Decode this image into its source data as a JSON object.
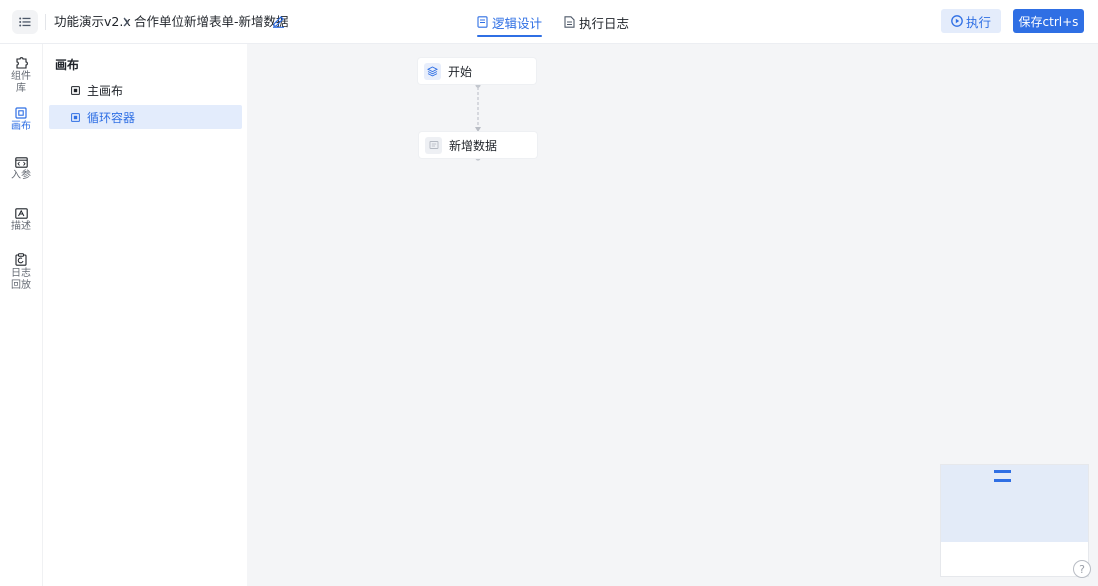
{
  "header": {
    "breadcrumb_app": "功能演示v2.x",
    "breadcrumb_page": "合作单位新增表单-新增数据",
    "tabs": [
      {
        "label": "逻辑设计",
        "active": true
      },
      {
        "label": "执行日志",
        "active": false
      }
    ],
    "run_label": "执行",
    "save_label": "保存ctrl+s"
  },
  "rail": {
    "items": [
      {
        "label": "组件库",
        "icon": "puzzle-icon",
        "active": false
      },
      {
        "label": "画布",
        "icon": "canvas-icon",
        "active": true
      },
      {
        "label": "入参",
        "icon": "code-window-icon",
        "active": false
      },
      {
        "label": "描述",
        "icon": "text-box-icon",
        "active": false
      },
      {
        "label": "日志回放",
        "icon": "clipboard-refresh-icon",
        "active": false
      }
    ]
  },
  "panel": {
    "title": "画布",
    "items": [
      {
        "label": "主画布",
        "selected": false
      },
      {
        "label": "循环容器",
        "selected": true
      }
    ]
  },
  "canvas": {
    "nodes": [
      {
        "label": "开始",
        "icon": "layers-icon"
      },
      {
        "label": "新增数据",
        "icon": "form-icon"
      }
    ]
  },
  "help": {
    "label": "?"
  },
  "colors": {
    "accent": "#2f6fe4",
    "accent_light": "#e4ecfb",
    "canvas_bg": "#f4f5f7"
  }
}
